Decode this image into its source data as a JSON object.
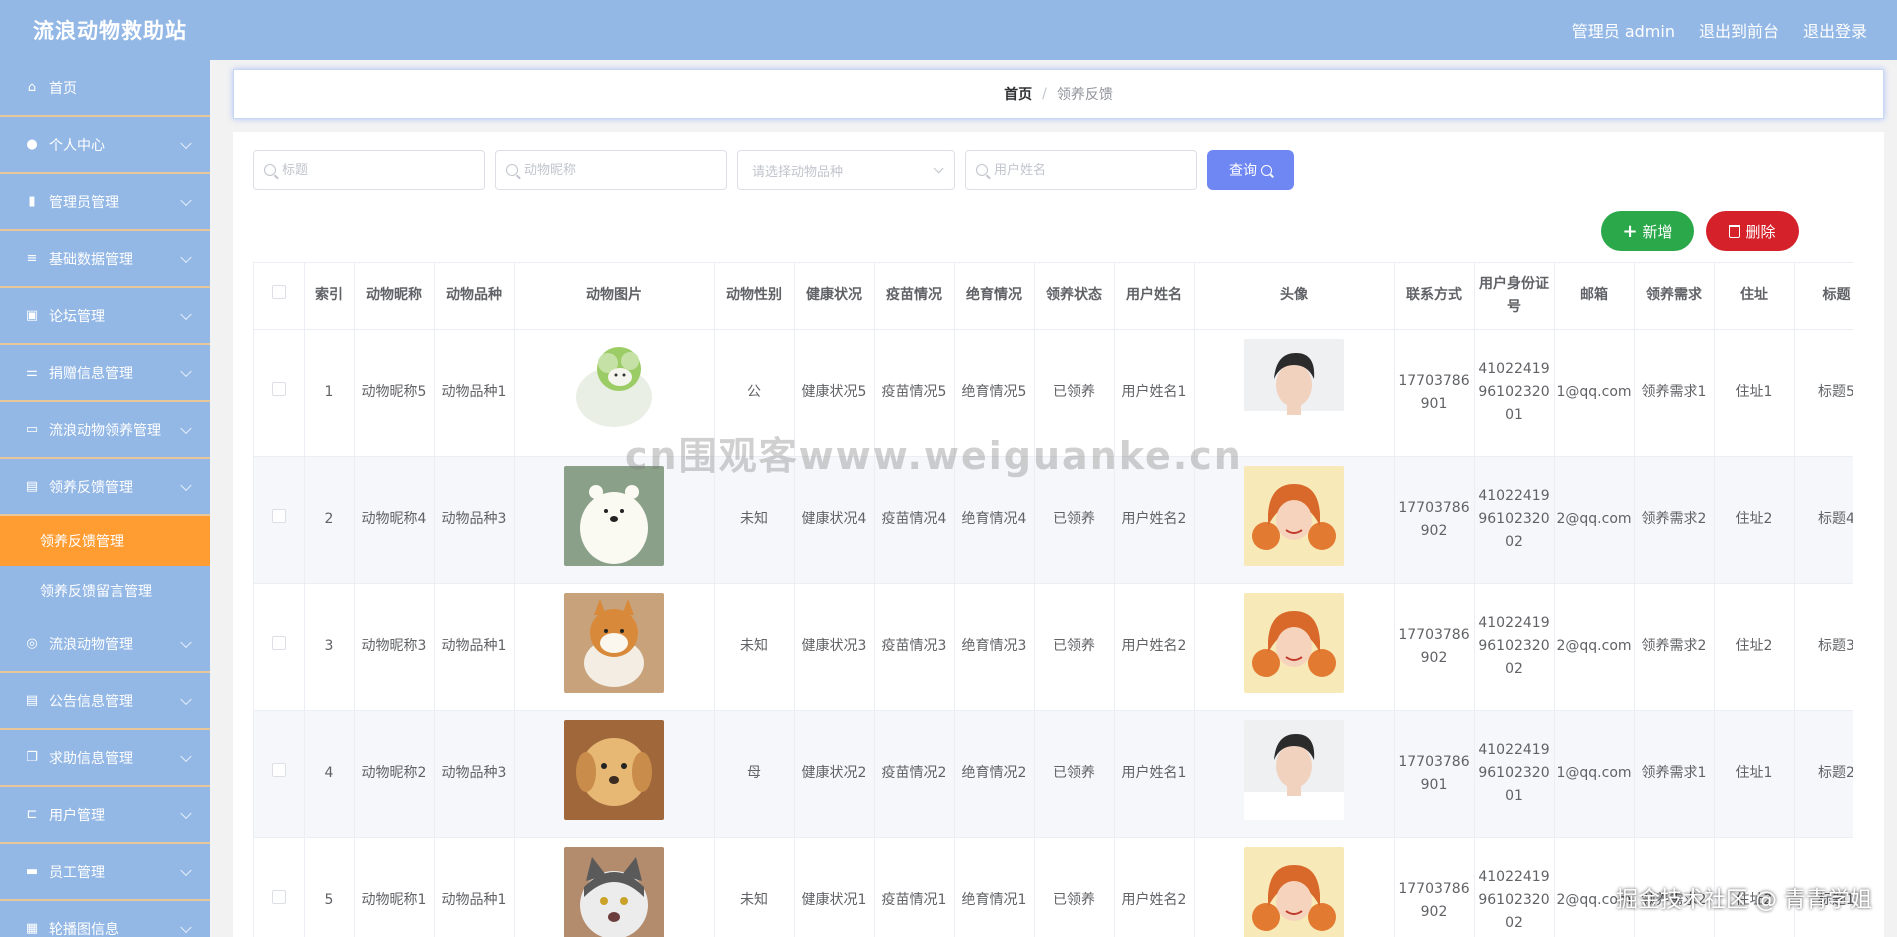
{
  "header": {
    "title": "流浪动物救助站",
    "admin_label": "管理员 admin",
    "front_label": "退出到前台",
    "logout_label": "退出登录"
  },
  "sidebar": {
    "items": [
      {
        "label": "首页",
        "icon": "home-icon",
        "glyph": "⌂",
        "chevron": false
      },
      {
        "label": "个人中心",
        "icon": "user-icon",
        "glyph": "●",
        "chevron": true
      },
      {
        "label": "管理员管理",
        "icon": "bar-chart-icon",
        "glyph": "▮",
        "chevron": true
      },
      {
        "label": "基础数据管理",
        "icon": "list-icon",
        "glyph": "≡",
        "chevron": true
      },
      {
        "label": "论坛管理",
        "icon": "briefcase-icon",
        "glyph": "▣",
        "chevron": true
      },
      {
        "label": "捐赠信息管理",
        "icon": "sliders-icon",
        "glyph": "⚌",
        "chevron": true
      },
      {
        "label": "流浪动物领养管理",
        "icon": "message-icon",
        "glyph": "▭",
        "chevron": true
      },
      {
        "label": "领养反馈管理",
        "icon": "document-icon",
        "glyph": "▤",
        "chevron": true
      }
    ],
    "submenu": [
      {
        "label": "领养反馈管理",
        "active": true
      },
      {
        "label": "领养反馈留言管理",
        "active": false
      }
    ],
    "items_after": [
      {
        "label": "流浪动物管理",
        "icon": "globe-icon",
        "glyph": "◎",
        "chevron": true
      },
      {
        "label": "公告信息管理",
        "icon": "clipboard-icon",
        "glyph": "▤",
        "chevron": true
      },
      {
        "label": "求助信息管理",
        "icon": "copy-icon",
        "glyph": "❐",
        "chevron": true
      },
      {
        "label": "用户管理",
        "icon": "crop-icon",
        "glyph": "⊏",
        "chevron": true
      },
      {
        "label": "员工管理",
        "icon": "chat-icon",
        "glyph": "▬",
        "chevron": true
      },
      {
        "label": "轮播图信息",
        "icon": "image-icon",
        "glyph": "▦",
        "chevron": true
      }
    ]
  },
  "breadcrumb": {
    "home": "首页",
    "separator": "/",
    "current": "领养反馈"
  },
  "search": {
    "title_placeholder": "标题",
    "animal_name_placeholder": "动物昵称",
    "breed_placeholder": "请选择动物品种",
    "username_placeholder": "用户姓名",
    "query_label": "查询"
  },
  "actions": {
    "add_label": "新增",
    "delete_label": "删除"
  },
  "table": {
    "columns": [
      "索引",
      "动物昵称",
      "动物品种",
      "动物图片",
      "动物性别",
      "健康状况",
      "疫苗情况",
      "绝育情况",
      "领养状态",
      "用户姓名",
      "头像",
      "联系方式",
      "用户身份证号",
      "邮箱",
      "领养需求",
      "住址",
      "标题"
    ],
    "rows": [
      {
        "index": "1",
        "name": "动物昵称5",
        "breed": "动物品种1",
        "animal_pic": "cabbage-dog",
        "gender": "公",
        "health": "健康状况5",
        "vaccine": "疫苗情况5",
        "sterile": "绝育情况5",
        "status": "已领养",
        "user": "用户姓名1",
        "avatar": "male",
        "phone": "17703786901",
        "idcard": "410224199610232001",
        "email": "1@qq.com",
        "need": "领养需求1",
        "address": "住址1",
        "title": "标题5"
      },
      {
        "index": "2",
        "name": "动物昵称4",
        "breed": "动物品种3",
        "animal_pic": "polar-bear",
        "gender": "未知",
        "health": "健康状况4",
        "vaccine": "疫苗情况4",
        "sterile": "绝育情况4",
        "status": "已领养",
        "user": "用户姓名2",
        "avatar": "female",
        "phone": "17703786902",
        "idcard": "410224199610232002",
        "email": "2@qq.com",
        "need": "领养需求2",
        "address": "住址2",
        "title": "标题4"
      },
      {
        "index": "3",
        "name": "动物昵称3",
        "breed": "动物品种1",
        "animal_pic": "shiba",
        "gender": "未知",
        "health": "健康状况3",
        "vaccine": "疫苗情况3",
        "sterile": "绝育情况3",
        "status": "已领养",
        "user": "用户姓名2",
        "avatar": "female",
        "phone": "17703786902",
        "idcard": "410224199610232002",
        "email": "2@qq.com",
        "need": "领养需求2",
        "address": "住址2",
        "title": "标题3"
      },
      {
        "index": "4",
        "name": "动物昵称2",
        "breed": "动物品种3",
        "animal_pic": "puppy",
        "gender": "母",
        "health": "健康状况2",
        "vaccine": "疫苗情况2",
        "sterile": "绝育情况2",
        "status": "已领养",
        "user": "用户姓名1",
        "avatar": "male",
        "phone": "17703786901",
        "idcard": "410224199610232001",
        "email": "1@qq.com",
        "need": "领养需求1",
        "address": "住址1",
        "title": "标题2"
      },
      {
        "index": "5",
        "name": "动物昵称1",
        "breed": "动物品种1",
        "animal_pic": "cat",
        "gender": "未知",
        "health": "健康状况1",
        "vaccine": "疫苗情况1",
        "sterile": "绝育情况1",
        "status": "已领养",
        "user": "用户姓名2",
        "avatar": "female",
        "phone": "17703786902",
        "idcard": "410224199610232002",
        "email": "2@qq.com",
        "need": "领养需求2",
        "address": "住址2",
        "title": "标题1"
      }
    ]
  },
  "watermark": "cn围观客www.weiguanke.cn",
  "corner_mark": "掘金技术社区 @ 青青学姐",
  "colors": {
    "header_bg": "#94b8e6",
    "sidebar_bg": "#94b8e6",
    "active_menu": "#ff9d33",
    "query_button": "#6f87f2",
    "add_button": "#2aa84a",
    "delete_button": "#d4212a"
  }
}
